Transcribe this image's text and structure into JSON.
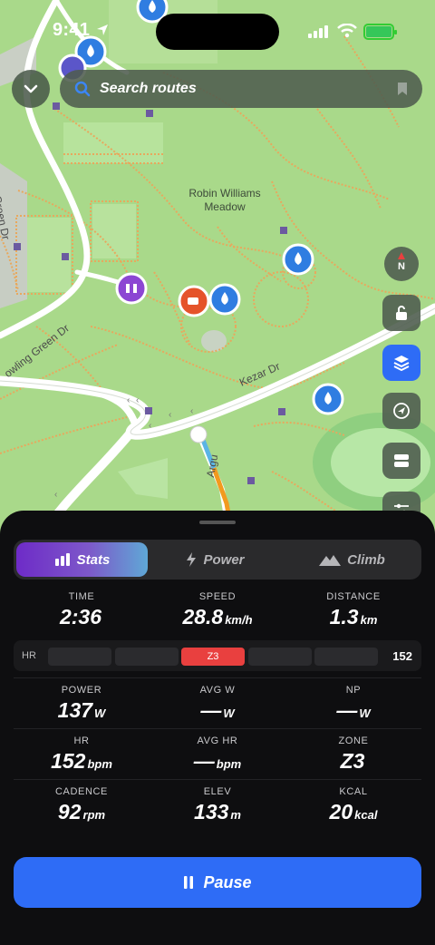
{
  "status_bar": {
    "time": "9:41"
  },
  "search": {
    "placeholder": "Search routes"
  },
  "map": {
    "place_label": "Robin Williams\nMeadow",
    "roads": {
      "kezar": "Kezar Dr",
      "bowling_green_left": "Bowling Green Dr",
      "bowling_green_diag": "owling Green Dr",
      "arguello": "Argu"
    },
    "compass_label": "N"
  },
  "tabs": [
    {
      "label": "Stats",
      "icon": "bar-chart-icon",
      "active": true
    },
    {
      "label": "Power",
      "icon": "lightning-icon",
      "active": false
    },
    {
      "label": "Climb",
      "icon": "mountain-icon",
      "active": false
    }
  ],
  "primary_metrics": [
    {
      "label": "TIME",
      "value": "2:36",
      "unit": ""
    },
    {
      "label": "SPEED",
      "value": "28.8",
      "unit": "km/h"
    },
    {
      "label": "DISTANCE",
      "value": "1.3",
      "unit": "km"
    }
  ],
  "hr_zones": {
    "label": "HR",
    "zones": [
      "",
      "",
      "Z3",
      "",
      ""
    ],
    "active_zone_index": 2,
    "value": "152",
    "active_color": "#e9403f"
  },
  "grid_metrics": [
    {
      "label": "POWER",
      "value": "137",
      "unit": "W"
    },
    {
      "label": "AVG W",
      "value": "—",
      "unit": "W"
    },
    {
      "label": "NP",
      "value": "—",
      "unit": "W"
    },
    {
      "label": "HR",
      "value": "152",
      "unit": "bpm"
    },
    {
      "label": "AVG HR",
      "value": "—",
      "unit": "bpm"
    },
    {
      "label": "ZONE",
      "value": "Z3",
      "unit": ""
    },
    {
      "label": "CADENCE",
      "value": "92",
      "unit": "rpm"
    },
    {
      "label": "ELEV",
      "value": "133",
      "unit": "m"
    },
    {
      "label": "KCAL",
      "value": "20",
      "unit": "kcal"
    }
  ],
  "pause_button": {
    "label": "Pause"
  },
  "colors": {
    "accent": "#2e6cf6",
    "map_green": "#a9d98a",
    "path_orange": "#e8a85d"
  }
}
